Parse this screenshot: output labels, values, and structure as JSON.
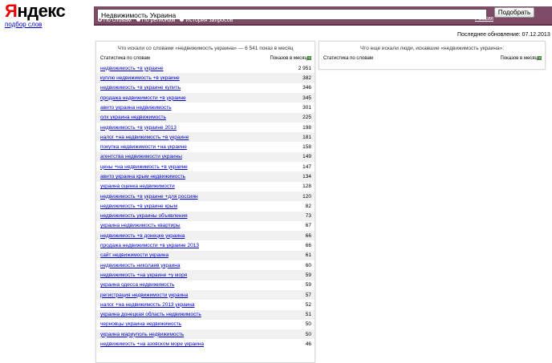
{
  "logo": {
    "first": "Я",
    "rest": "ндекс"
  },
  "subnav_link": "подбор слов",
  "search": {
    "value": "Недвижимость Украина",
    "button": "Подобрать"
  },
  "radios": [
    {
      "label": "По словам",
      "active": true
    },
    {
      "label": "По регионам",
      "active": false
    },
    {
      "label": "История запросов",
      "active": false
    }
  ],
  "region_link": "Россия",
  "updated": "Последнее обновление: 07.12.2013",
  "left_panel": {
    "title": "Что искали со словами «недвижимость украина» — 6 541 показ в месяц",
    "col_words": "Статистика по словам",
    "col_shows": "Показов в месяц",
    "rows": [
      {
        "q": "недвижимость +в украине",
        "n": "2 951"
      },
      {
        "q": "куплю недвижимость +в украине",
        "n": "382"
      },
      {
        "q": "недвижимость +в украине купить",
        "n": "346"
      },
      {
        "q": "продажа недвижимости +в украине",
        "n": "345"
      },
      {
        "q": "авито украина недвижимость",
        "n": "301"
      },
      {
        "q": "олх украина недвижимость",
        "n": "225"
      },
      {
        "q": "недвижимость +в украине 2013",
        "n": "198"
      },
      {
        "q": "налог +на недвижимость +в украине",
        "n": "181"
      },
      {
        "q": "покупка недвижимости +на украине",
        "n": "158"
      },
      {
        "q": "агентства недвижимости украины",
        "n": "149"
      },
      {
        "q": "цены +на недвижимость +в украине",
        "n": "147"
      },
      {
        "q": "авито украина крым недвижимость",
        "n": "134"
      },
      {
        "q": "украина оценка недвижимости",
        "n": "128"
      },
      {
        "q": "недвижимость +в украине +для россиян",
        "n": "120"
      },
      {
        "q": "недвижимость +в украине крым",
        "n": "82"
      },
      {
        "q": "недвижимость украины объявления",
        "n": "73"
      },
      {
        "q": "украина недвижимость квартиры",
        "n": "67"
      },
      {
        "q": "недвижимость +в донецке украина",
        "n": "66"
      },
      {
        "q": "продажа недвижимости +в украине 2013",
        "n": "66"
      },
      {
        "q": "сайт недвижимости украина",
        "n": "61"
      },
      {
        "q": "недвижимость николаев украина",
        "n": "60"
      },
      {
        "q": "недвижимость +на украине +у моря",
        "n": "59"
      },
      {
        "q": "украина одесса недвижимость",
        "n": "59"
      },
      {
        "q": "регистрация недвижимости украина",
        "n": "57"
      },
      {
        "q": "налог +на недвижимость 2013 украина",
        "n": "52"
      },
      {
        "q": "украина донецкая область недвижимость",
        "n": "51"
      },
      {
        "q": "черновцы украина недвижимость",
        "n": "50"
      },
      {
        "q": "украина мариуполь недвижимость",
        "n": "50"
      },
      {
        "q": "недвижимость +на азовском море украина",
        "n": "46"
      }
    ]
  },
  "right_panel": {
    "title": "Что еще искали люди, искавшие «недвижимость украина»:",
    "col_words": "Статистика по словам",
    "col_shows": "Показов в месяц"
  },
  "help_icon_glyph": "?",
  "colors": {
    "header": "#7f4a66",
    "link": "#0000cc",
    "logo_red": "#ee0000"
  }
}
